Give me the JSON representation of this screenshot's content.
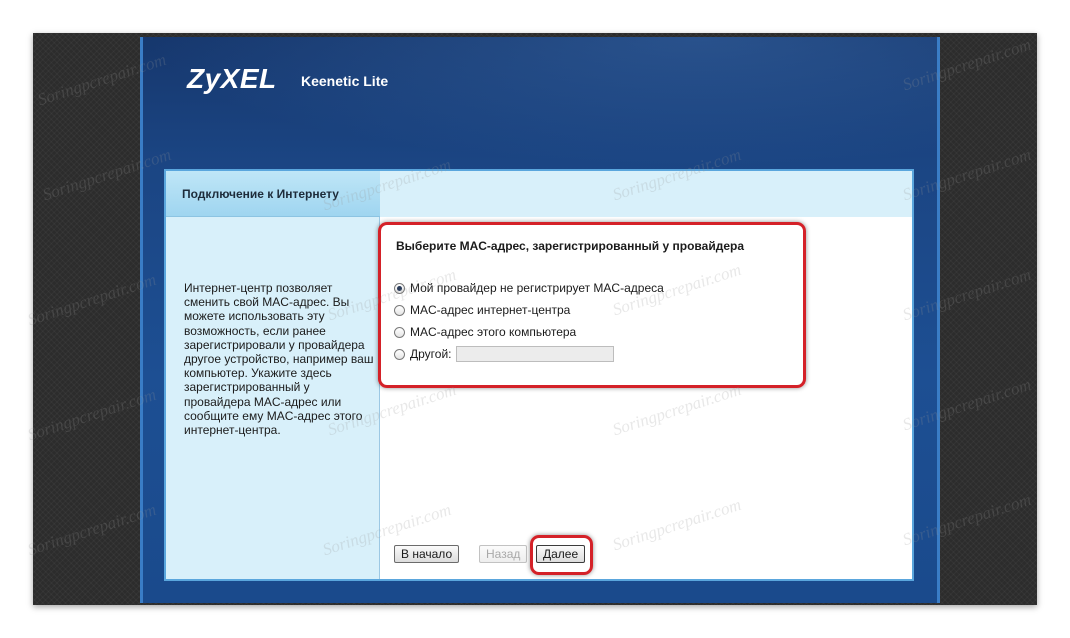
{
  "header": {
    "brand": "ZyXEL",
    "model": "Keenetic Lite"
  },
  "sidebar": {
    "tab_label": "Подключение к Интернету",
    "help_text": "Интернет-центр позволяет сменить свой MAC-адрес. Вы можете использовать эту возможность, если ранее зарегистрировали у провайдера другое устройство, например ваш компьютер. Укажите здесь зарегистрированный у провайдера MAC-адрес или сообщите ему MAC-адрес этого интернет-центра."
  },
  "form": {
    "title": "Выберите MAC-адрес, зарегистрированный у провайдера",
    "options": [
      {
        "label": "Мой провайдер не регистрирует MAC-адреса",
        "checked": true
      },
      {
        "label": "MAC-адрес интернет-центра",
        "checked": false
      },
      {
        "label": "MAC-адрес этого компьютера",
        "checked": false
      },
      {
        "label": "Другой:",
        "checked": false
      }
    ],
    "other_mac_value": ""
  },
  "buttons": {
    "start_label": "В начало",
    "back_label": "Назад",
    "next_label": "Далее"
  },
  "watermark": "Soringpcrepair.com",
  "colors": {
    "router_blue": "#1b4583",
    "panel_light_blue": "#d8f0fa",
    "highlight_red": "#d42128"
  }
}
